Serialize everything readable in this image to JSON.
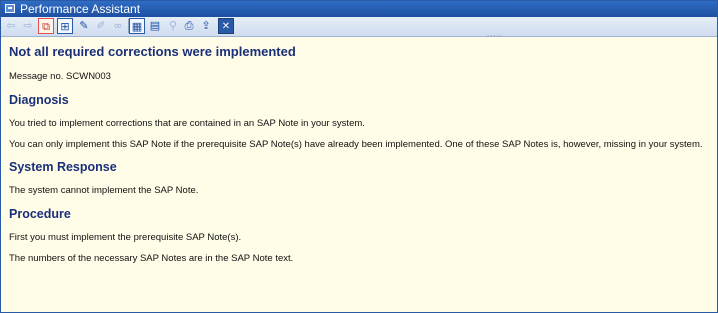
{
  "window": {
    "title": "Performance Assistant"
  },
  "toolbar": {
    "buttons": [
      {
        "name": "back-arrow-icon",
        "glyph": "⇦",
        "enabled": false
      },
      {
        "name": "forward-arrow-icon",
        "glyph": "⇨",
        "enabled": false
      },
      {
        "name": "document-link-icon",
        "glyph": "⧉",
        "enabled": true,
        "active": true
      },
      {
        "name": "technical-info-icon",
        "glyph": "⊞",
        "enabled": true
      },
      {
        "name": "edit-icon",
        "glyph": "✎",
        "enabled": true
      },
      {
        "name": "pen-icon",
        "glyph": "✐",
        "enabled": false
      },
      {
        "name": "glasses-icon",
        "glyph": "∞",
        "enabled": false
      },
      {
        "name": "table-icon",
        "glyph": "▦",
        "enabled": true
      },
      {
        "name": "layout-icon",
        "glyph": "▤",
        "enabled": true
      },
      {
        "name": "pin-icon",
        "glyph": "⚲",
        "enabled": false
      },
      {
        "name": "print-icon",
        "glyph": "⎙",
        "enabled": true
      },
      {
        "name": "export-icon",
        "glyph": "⇪",
        "enabled": true
      },
      {
        "name": "close-icon",
        "glyph": "✕",
        "enabled": true
      }
    ]
  },
  "content": {
    "heading": "Not all required corrections were implemented",
    "message_no": "Message no. SCWN003",
    "diagnosis": {
      "title": "Diagnosis",
      "lines": [
        "You tried to implement corrections that are contained in an SAP Note in your system.",
        "You can only implement this SAP Note if the prerequisite SAP Note(s) have already been implemented. One of these SAP Notes is, however, missing in your system."
      ]
    },
    "system_response": {
      "title": "System Response",
      "lines": [
        "The system cannot implement the SAP Note."
      ]
    },
    "procedure": {
      "title": "Procedure",
      "lines": [
        "First you must implement the prerequisite SAP Note(s).",
        "The numbers of the necessary SAP Notes are in the SAP Note text."
      ]
    }
  },
  "colors": {
    "title_bar": "#1d4fa0",
    "heading": "#1b2f7a",
    "background": "#fffde8"
  }
}
